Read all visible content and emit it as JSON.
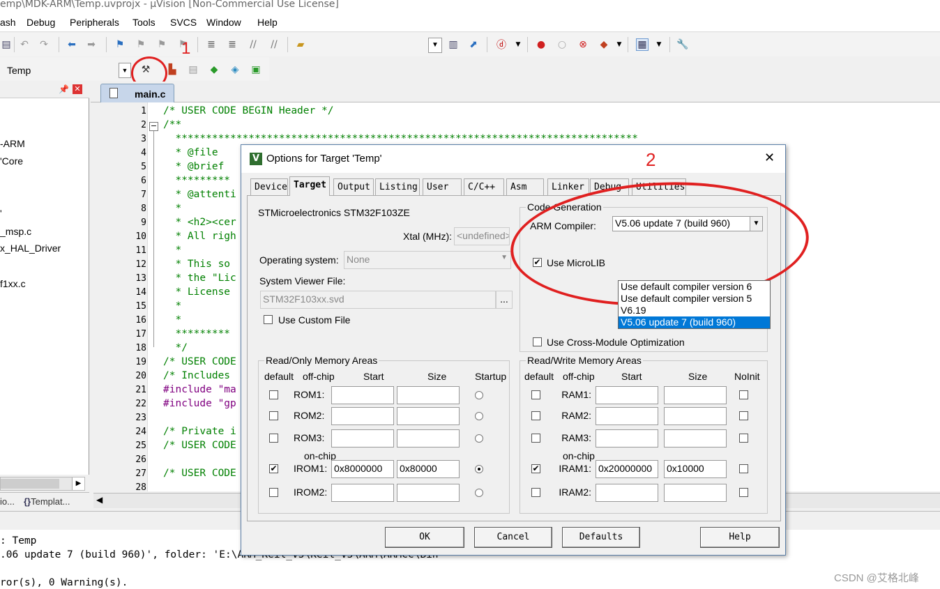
{
  "window": {
    "title": "emp\\MDK-ARM\\Temp.uvprojx - µVision  [Non-Commercial Use License]"
  },
  "menu": [
    "ash",
    "Debug",
    "Peripherals",
    "Tools",
    "SVCS",
    "Window",
    "Help"
  ],
  "toolbar": {
    "target_name": "Temp",
    "annotation_1": "1",
    "annotation_2": "2"
  },
  "project_panel": {
    "items": [
      "-ARM",
      "'Core",
      "'",
      "_msp.c",
      "x_HAL_Driver",
      "f1xx.c"
    ],
    "bottom_tabs": [
      "io...",
      "Templat..."
    ]
  },
  "editor": {
    "tab": "main.c",
    "lines": [
      {
        "n": "1",
        "text": "/* USER CODE BEGIN Header */",
        "kind": "comment"
      },
      {
        "n": "2",
        "text": "/**",
        "kind": "comment"
      },
      {
        "n": "3",
        "text": "  ****************************************************************************",
        "kind": "comment"
      },
      {
        "n": "4",
        "text": "  * @file",
        "kind": "comment"
      },
      {
        "n": "5",
        "text": "  * @brief",
        "kind": "comment"
      },
      {
        "n": "6",
        "text": "  *********",
        "kind": "comment"
      },
      {
        "n": "7",
        "text": "  * @attenti",
        "kind": "comment"
      },
      {
        "n": "8",
        "text": "  *",
        "kind": "comment"
      },
      {
        "n": "9",
        "text": "  * <h2><cer",
        "kind": "comment"
      },
      {
        "n": "10",
        "text": "  * All righ",
        "kind": "comment"
      },
      {
        "n": "11",
        "text": "  *",
        "kind": "comment"
      },
      {
        "n": "12",
        "text": "  * This so",
        "kind": "comment"
      },
      {
        "n": "13",
        "text": "  * the \"Lic",
        "kind": "comment"
      },
      {
        "n": "14",
        "text": "  * License",
        "kind": "comment"
      },
      {
        "n": "15",
        "text": "  *",
        "kind": "comment"
      },
      {
        "n": "16",
        "text": "  *",
        "kind": "comment"
      },
      {
        "n": "17",
        "text": "  *********",
        "kind": "comment"
      },
      {
        "n": "18",
        "text": "  */",
        "kind": "comment"
      },
      {
        "n": "19",
        "text": "/* USER CODE",
        "kind": "comment"
      },
      {
        "n": "20",
        "text": "/* Includes ",
        "kind": "comment"
      },
      {
        "n": "21",
        "text": "#include \"ma",
        "kind": "pre"
      },
      {
        "n": "22",
        "text": "#include \"gp",
        "kind": "pre"
      },
      {
        "n": "23",
        "text": "",
        "kind": "comment"
      },
      {
        "n": "24",
        "text": "/* Private i",
        "kind": "comment"
      },
      {
        "n": "25",
        "text": "/* USER CODE",
        "kind": "comment"
      },
      {
        "n": "26",
        "text": "",
        "kind": "comment"
      },
      {
        "n": "27",
        "text": "/* USER CODE",
        "kind": "comment"
      },
      {
        "n": "28",
        "text": "",
        "kind": "comment"
      }
    ]
  },
  "output": {
    "lines": [
      ": Temp",
      ".06 update 7 (build 960)', folder: 'E:\\ARM_Keil_V5\\Keil_V5\\ARM\\ARMCC\\Bin'",
      "",
      "ror(s), 0 Warning(s)."
    ],
    "watermark": "CSDN @艾格北峰"
  },
  "dialog": {
    "title": "Options for Target 'Temp'",
    "tabs": [
      "Device",
      "Target",
      "Output",
      "Listing",
      "User",
      "C/C++",
      "Asm",
      "Linker",
      "Debug",
      "Utilities"
    ],
    "active_tab": "Target",
    "device": "STMicroelectronics STM32F103ZE",
    "xtal_label": "Xtal (MHz):",
    "xtal_value": "<undefined>",
    "os_label": "Operating system:",
    "os_value": "None",
    "svf_label": "System Viewer File:",
    "svf_value": "STM32F103xx.svd",
    "svf_browse": "...",
    "custom_file": "Use Custom File",
    "codegen": {
      "title": "Code Generation",
      "compiler_label": "ARM Compiler:",
      "compiler_value": "V5.06 update 7 (build 960)",
      "options": [
        "Use default compiler version 6",
        "Use default compiler version 5",
        "V6.19",
        "V5.06 update 7 (build 960)"
      ],
      "microlib": "Use MicroLIB",
      "cross_module": "Use Cross-Module Optimization"
    },
    "rom": {
      "title": "Read/Only Memory Areas",
      "headers": [
        "default",
        "off-chip",
        "Start",
        "Size",
        "Startup"
      ],
      "rows": [
        {
          "label": "ROM1:",
          "start": "",
          "size": ""
        },
        {
          "label": "ROM2:",
          "start": "",
          "size": ""
        },
        {
          "label": "ROM3:",
          "start": "",
          "size": ""
        },
        {
          "label": "IROM1:",
          "start": "0x8000000",
          "size": "0x80000"
        },
        {
          "label": "IROM2:",
          "start": "",
          "size": ""
        }
      ],
      "onchip": "on-chip"
    },
    "ram": {
      "title": "Read/Write Memory Areas",
      "headers": [
        "default",
        "off-chip",
        "Start",
        "Size",
        "NoInit"
      ],
      "rows": [
        {
          "label": "RAM1:",
          "start": "",
          "size": ""
        },
        {
          "label": "RAM2:",
          "start": "",
          "size": ""
        },
        {
          "label": "RAM3:",
          "start": "",
          "size": ""
        },
        {
          "label": "IRAM1:",
          "start": "0x20000000",
          "size": "0x10000"
        },
        {
          "label": "IRAM2:",
          "start": "",
          "size": ""
        }
      ],
      "onchip": "on-chip"
    },
    "buttons": {
      "ok": "OK",
      "cancel": "Cancel",
      "defaults": "Defaults",
      "help": "Help"
    }
  },
  "colors": {
    "annotation": "#e02020",
    "selection": "#0078d7"
  }
}
